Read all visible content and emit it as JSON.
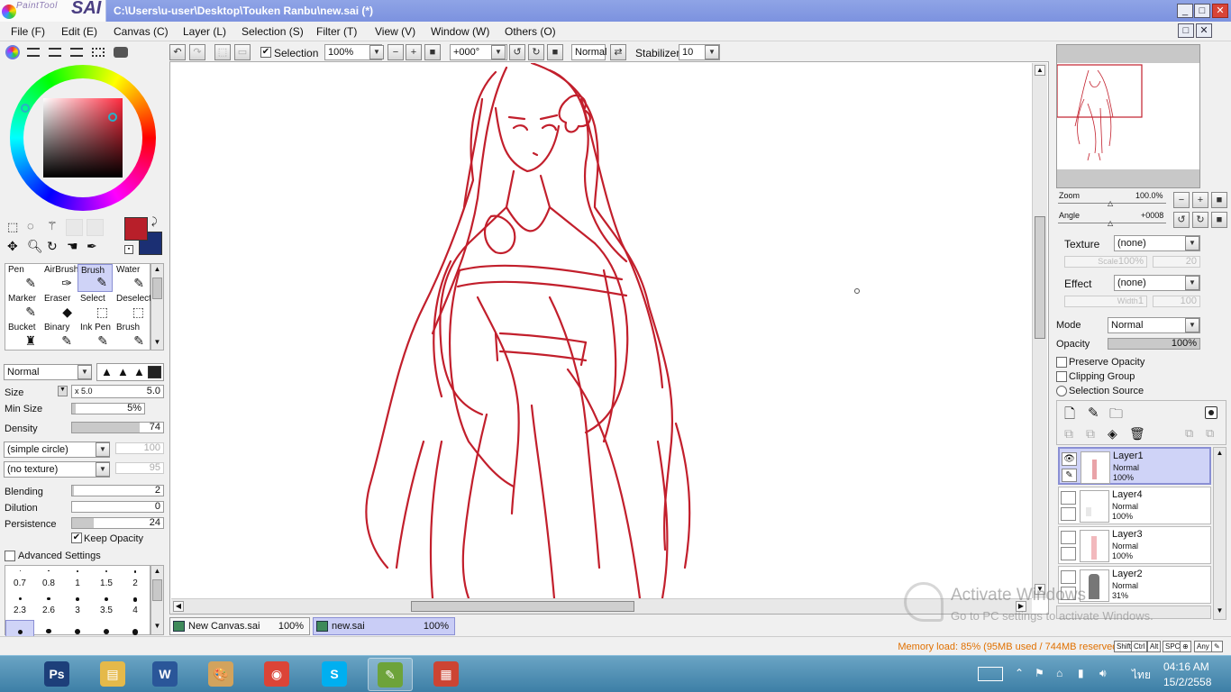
{
  "app": {
    "name": "PaintTool SAI",
    "logo_small": "PaintTool",
    "logo_big": "SAI",
    "window_title": "C:\\Users\\u-user\\Desktop\\Touken Ranbu\\new.sai (*)",
    "title_buttons": [
      "_",
      "□",
      "✕"
    ],
    "brand_color": "#7c92df"
  },
  "menu": [
    "File (F)",
    "Edit (E)",
    "Canvas (C)",
    "Layer (L)",
    "Selection (S)",
    "Filter (T)",
    "View (V)",
    "Window (W)",
    "Others (O)"
  ],
  "toolbar": {
    "selection_label": "Selection",
    "selection_checked": true,
    "zoom": "100%",
    "angle": "+000°",
    "blend_mode": "Normal",
    "stabilizer_label": "Stabilizer",
    "stabilizer_value": "10"
  },
  "colors": {
    "primary": "#b81f2a",
    "secondary": "#1b2f73",
    "sketch": "#c21f2c"
  },
  "tools": {
    "rows": [
      [
        {
          "label": "Pen",
          "icon": "pen-icon",
          "glyph": "✎"
        },
        {
          "label": "AirBrush",
          "icon": "airbrush-icon",
          "glyph": "✑"
        },
        {
          "label": "Brush",
          "icon": "brush-icon",
          "glyph": "✎",
          "active": true
        },
        {
          "label": "Water",
          "icon": "water-icon",
          "glyph": "✎"
        }
      ],
      [
        {
          "label": "Marker",
          "icon": "marker-icon",
          "glyph": "✎"
        },
        {
          "label": "Eraser",
          "icon": "eraser-icon",
          "glyph": "◆"
        },
        {
          "label": "Select",
          "icon": "select-icon",
          "glyph": "⬚"
        },
        {
          "label": "Deselect",
          "icon": "deselect-icon",
          "glyph": "⬚"
        }
      ],
      [
        {
          "label": "Bucket",
          "icon": "bucket-icon",
          "glyph": "♜"
        },
        {
          "label": "Binary",
          "icon": "binary-icon",
          "glyph": "✎"
        },
        {
          "label": "Ink Pen",
          "icon": "ink-pen-icon",
          "glyph": "✎"
        },
        {
          "label": "Brush",
          "icon": "brush-icon",
          "glyph": "✎"
        }
      ]
    ]
  },
  "brush": {
    "mode": "Normal",
    "size_label": "Size",
    "size_multiplier": "x 5.0",
    "size_value": "5.0",
    "min_size_label": "Min Size",
    "min_size_value": "5%",
    "density_label": "Density",
    "density_value": "74",
    "shape": "(simple circle)",
    "shape_value": "100",
    "texture": "(no texture)",
    "texture_value": "95",
    "blending_label": "Blending",
    "blending_value": "2",
    "dilution_label": "Dilution",
    "dilution_value": "0",
    "persistence_label": "Persistence",
    "persistence_value": "24",
    "keep_opacity_label": "Keep Opacity",
    "keep_opacity_checked": true,
    "advanced_label": "Advanced Settings",
    "advanced_checked": false,
    "size_presets": [
      "0.7",
      "0.8",
      "1",
      "1.5",
      "2",
      "2.3",
      "2.6",
      "3",
      "3.5",
      "4"
    ]
  },
  "navigator": {
    "zoom_label": "Zoom",
    "zoom_value": "100.0%",
    "angle_label": "Angle",
    "angle_value": "+0008"
  },
  "layer_props": {
    "texture_label": "Texture",
    "texture_value": "(none)",
    "scale_label": "Scale",
    "scale_value": "100%",
    "scale_right": "20",
    "effect_label": "Effect",
    "effect_value": "(none)",
    "width_label": "Width",
    "width_value": "1",
    "width_right": "100",
    "mode_label": "Mode",
    "mode_value": "Normal",
    "opacity_label": "Opacity",
    "opacity_value": "100%",
    "preserve_opacity": "Preserve Opacity",
    "clipping_group": "Clipping Group",
    "selection_source": "Selection Source"
  },
  "layers": [
    {
      "name": "Layer1",
      "mode": "Normal",
      "opacity": "100%",
      "active": true,
      "visible": true
    },
    {
      "name": "Layer4",
      "mode": "Normal",
      "opacity": "100%",
      "active": false,
      "visible": false
    },
    {
      "name": "Layer3",
      "mode": "Normal",
      "opacity": "100%",
      "active": false,
      "visible": false
    },
    {
      "name": "Layer2",
      "mode": "Normal",
      "opacity": "31%",
      "active": false,
      "visible": false
    }
  ],
  "documents": [
    {
      "name": "New Canvas.sai",
      "zoom": "100%",
      "active": false
    },
    {
      "name": "new.sai",
      "zoom": "100%",
      "active": true
    }
  ],
  "status": {
    "memory": "Memory load: 85% (95MB used / 744MB reserved)",
    "keys": [
      "Shift",
      "Ctrl",
      "Alt",
      "SPC",
      "⊕",
      "Any",
      "✎"
    ]
  },
  "watermark": {
    "title": "Activate Windows",
    "subtitle": "Go to PC settings to activate Windows."
  },
  "taskbar": {
    "apps": [
      {
        "name": "photoshop-icon",
        "glyph": "Ps",
        "color": "#1d3f7a"
      },
      {
        "name": "file-explorer-icon",
        "glyph": "▤",
        "color": "#e5b94a"
      },
      {
        "name": "word-icon",
        "glyph": "W",
        "color": "#2a5699"
      },
      {
        "name": "paint-icon",
        "glyph": "🎨",
        "color": "#d2a35d"
      },
      {
        "name": "chrome-icon",
        "glyph": "◉",
        "color": "#db4437"
      },
      {
        "name": "skype-icon",
        "glyph": "S",
        "color": "#00aff0"
      },
      {
        "name": "painttool-sai-icon",
        "glyph": "✎",
        "color": "#6da33a",
        "active": true
      },
      {
        "name": "color-app-icon",
        "glyph": "▦",
        "color": "#c43"
      }
    ],
    "tray_lang": "ไทย",
    "time": "04:16 AM",
    "date": "15/2/2558"
  }
}
